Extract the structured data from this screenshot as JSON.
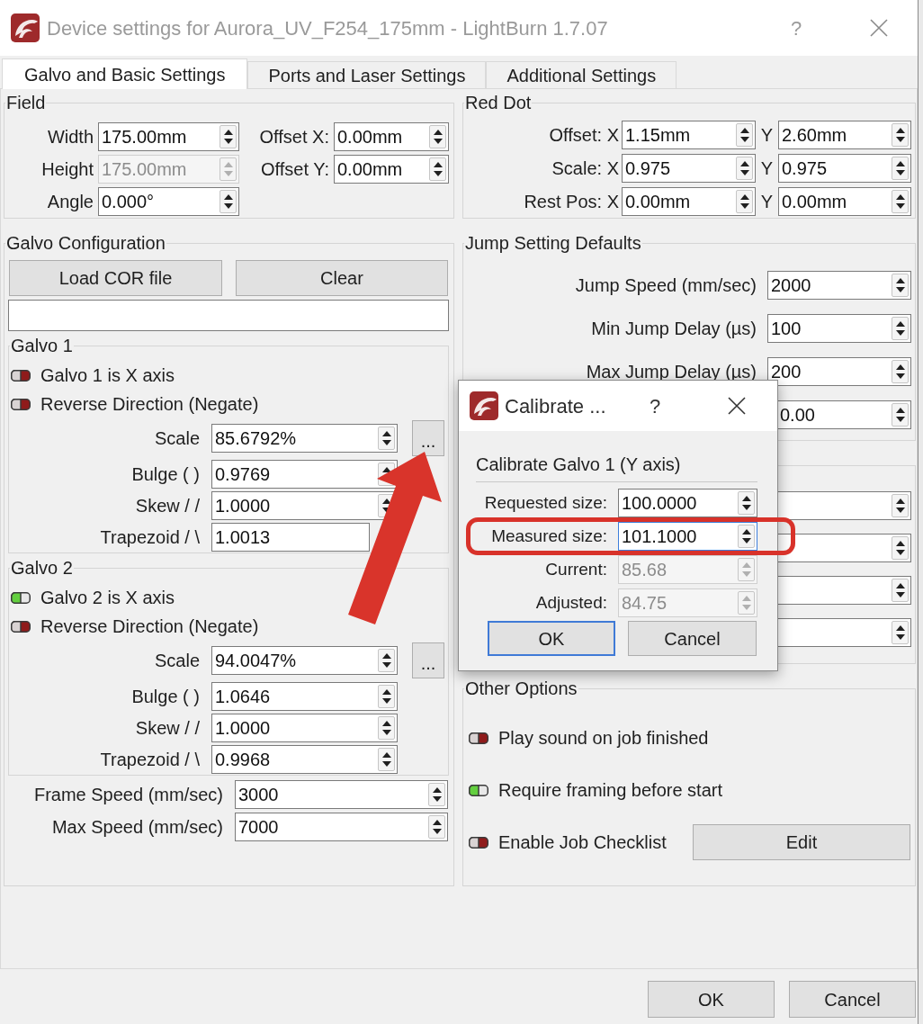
{
  "window": {
    "title": "Device settings for Aurora_UV_F254_175mm - LightBurn 1.7.07",
    "active": false,
    "help_button": "?"
  },
  "tabs": [
    {
      "label": "Galvo and Basic Settings",
      "selected": true
    },
    {
      "label": "Ports and Laser Settings",
      "selected": false
    },
    {
      "label": "Additional Settings",
      "selected": false
    }
  ],
  "field": {
    "title": "Field",
    "rows": [
      {
        "label": "Width",
        "value": "175.00mm",
        "disabled": false
      },
      {
        "label": "Height",
        "value": "175.00mm",
        "disabled": true
      },
      {
        "label": "Angle",
        "value": "0.000°",
        "disabled": false
      }
    ],
    "offsets": [
      {
        "label": "Offset X:",
        "value": "0.00mm"
      },
      {
        "label": "Offset Y:",
        "value": "0.00mm"
      }
    ]
  },
  "red_dot": {
    "title": "Red Dot",
    "rows": [
      {
        "label": "Offset: X",
        "x_value": "1.15mm",
        "y_label": "Y",
        "y_value": "2.60mm"
      },
      {
        "label": "Scale: X",
        "x_value": "0.975",
        "y_label": "Y",
        "y_value": "0.975"
      },
      {
        "label": "Rest Pos: X",
        "x_value": "0.00mm",
        "y_label": "Y",
        "y_value": "0.00mm"
      }
    ]
  },
  "galvo_configuration": {
    "title": "Galvo Configuration",
    "buttons": [
      "Load COR file",
      "Clear"
    ],
    "galvos": [
      {
        "title": "Galvo 1",
        "toggles": [
          {
            "label": "Galvo 1 is X axis",
            "on": false
          },
          {
            "label": "Reverse Direction (Negate)",
            "on": false
          }
        ],
        "scale": {
          "label": "Scale",
          "value": "85.6792%",
          "button": "..."
        },
        "params": [
          {
            "label": "Bulge ( )",
            "value": "0.9769"
          },
          {
            "label": "Skew / /",
            "value": "1.0000"
          },
          {
            "label": "Trapezoid / \\",
            "value": "1.0013"
          }
        ]
      },
      {
        "title": "Galvo 2",
        "toggles": [
          {
            "label": "Galvo 2 is X axis",
            "on": true
          },
          {
            "label": "Reverse Direction (Negate)",
            "on": false
          }
        ],
        "scale": {
          "label": "Scale",
          "value": "94.0047%",
          "button": "..."
        },
        "params": [
          {
            "label": "Bulge ( )",
            "value": "1.0646"
          },
          {
            "label": "Skew / /",
            "value": "1.0000"
          },
          {
            "label": "Trapezoid / \\",
            "value": "0.9968"
          }
        ]
      }
    ],
    "speeds": [
      {
        "label": "Frame Speed (mm/sec)",
        "value": "3000"
      },
      {
        "label": "Max Speed (mm/sec)",
        "value": "7000"
      }
    ]
  },
  "jump_setting_defaults": {
    "title": "Jump Setting Defaults",
    "rows": [
      {
        "label": "Jump Speed (mm/sec)",
        "value": "2000"
      },
      {
        "label": "Min Jump Delay (µs)",
        "value": "100"
      },
      {
        "label": "Max Jump Delay (µs)",
        "value": "200"
      },
      {
        "value": "0.00"
      }
    ]
  },
  "untitled_group": {
    "rows": [
      {
        "kind": "spin_box"
      },
      {
        "kind": "spin_box"
      },
      {
        "kind": "spin_box"
      },
      {
        "kind": "spin_box"
      }
    ]
  },
  "other_options": {
    "title": "Other Options",
    "toggles": [
      {
        "label": "Play sound on job finished",
        "on": false
      },
      {
        "label": "Require framing before start",
        "on": true
      },
      {
        "label": "Enable Job Checklist",
        "on": false,
        "button": "Edit"
      }
    ]
  },
  "buttons": [
    {
      "label": "OK"
    },
    {
      "label": "Cancel"
    }
  ],
  "calibrate_dialog": {
    "title": "Calibrate ...",
    "active": true,
    "help_button": "?",
    "heading": "Calibrate Galvo 1 (Y axis)",
    "rows": [
      {
        "label": "Requested size:",
        "value": "100.0000",
        "disabled": false,
        "focused": false,
        "highlighted": false
      },
      {
        "label": "Measured size:",
        "value": "101.1000",
        "disabled": false,
        "focused": true,
        "highlighted": true
      },
      {
        "label": "Current:",
        "value": "85.68",
        "disabled": true,
        "focused": false,
        "highlighted": false
      },
      {
        "label": "Adjusted:",
        "value": "84.75",
        "disabled": true,
        "focused": false,
        "highlighted": false
      }
    ],
    "buttons": [
      {
        "label": "OK",
        "default": true
      },
      {
        "label": "Cancel",
        "default": false
      }
    ]
  }
}
